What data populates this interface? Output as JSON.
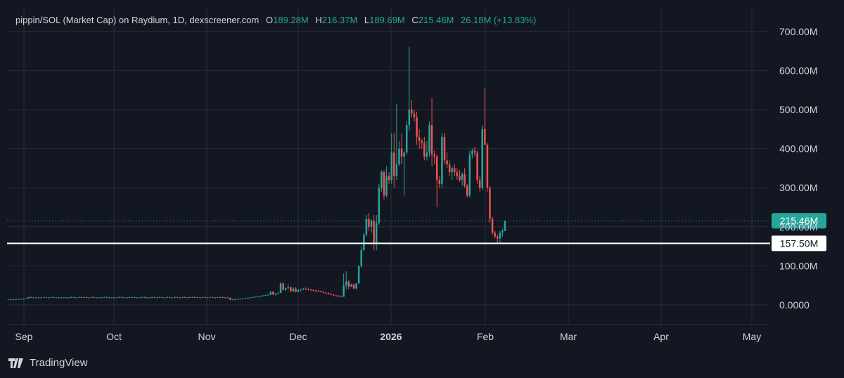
{
  "header": {
    "title": "pippin/SOL (Market Cap) on Raydium, 1D, dexscreener.com",
    "o_label": "O",
    "o_value": "189.28M",
    "h_label": "H",
    "h_value": "216.37M",
    "l_label": "L",
    "l_value": "189.69M",
    "c_label": "C",
    "c_value": "215.46M",
    "change": "26.18M (+13.83%)"
  },
  "brand": "TradingView",
  "colors": {
    "background": "#131722",
    "up": "#26a69a",
    "down": "#ef5350",
    "grid": "#2a2e39",
    "text": "#d1d4dc",
    "price_line": "#ffffff"
  },
  "chart_data": {
    "type": "candlestick",
    "y_axis": {
      "min": 0,
      "max": 700,
      "unit": "M",
      "ticks": [
        0,
        100,
        200,
        300,
        400,
        500,
        600,
        700
      ],
      "tick_labels": [
        "0.0000",
        "100.00M",
        "200.00M",
        "300.00M",
        "400.00M",
        "500.00M",
        "600.00M",
        "700.00M"
      ]
    },
    "x_axis": {
      "labels": [
        "Sep",
        "Oct",
        "Nov",
        "Dec",
        "2026",
        "Feb",
        "Mar",
        "Apr",
        "May"
      ]
    },
    "grid": true,
    "last_price": 215.46,
    "last_price_label": "215.46M",
    "horizontal_line": 157.5,
    "horizontal_line_label": "157.50M",
    "candles": [
      [
        14,
        15,
        13,
        14
      ],
      [
        14,
        15,
        13,
        14
      ],
      [
        14,
        15,
        13,
        14
      ],
      [
        14,
        16,
        13,
        15
      ],
      [
        15,
        16,
        14,
        15
      ],
      [
        15,
        16,
        14,
        15
      ],
      [
        15,
        17,
        14,
        16
      ],
      [
        16,
        18,
        15,
        17
      ],
      [
        17,
        21,
        16,
        20
      ],
      [
        20,
        21,
        18,
        19
      ],
      [
        19,
        20,
        18,
        19
      ],
      [
        19,
        20,
        18,
        19
      ],
      [
        19,
        20,
        18,
        19
      ],
      [
        19,
        20,
        18,
        19
      ],
      [
        19,
        20,
        18,
        20
      ],
      [
        20,
        20,
        18,
        19
      ],
      [
        19,
        20,
        18,
        19
      ],
      [
        19,
        21,
        18,
        20
      ],
      [
        20,
        21,
        18,
        19
      ],
      [
        19,
        20,
        18,
        19
      ],
      [
        19,
        20,
        18,
        19
      ],
      [
        19,
        20,
        18,
        19
      ],
      [
        19,
        20,
        18,
        19
      ],
      [
        19,
        20,
        18,
        19
      ],
      [
        19,
        20,
        18,
        19
      ],
      [
        19,
        21,
        18,
        20
      ],
      [
        20,
        21,
        18,
        19
      ],
      [
        19,
        20,
        18,
        19
      ],
      [
        19,
        21,
        18,
        20
      ],
      [
        20,
        21,
        18,
        19
      ],
      [
        19,
        21,
        18,
        20
      ],
      [
        20,
        21,
        18,
        19
      ],
      [
        19,
        20,
        18,
        19
      ],
      [
        19,
        21,
        18,
        20
      ],
      [
        20,
        21,
        18,
        19
      ],
      [
        19,
        20,
        18,
        19
      ],
      [
        19,
        20,
        18,
        19
      ],
      [
        19,
        20,
        18,
        19
      ],
      [
        19,
        21,
        18,
        20
      ],
      [
        20,
        21,
        18,
        19
      ],
      [
        19,
        20,
        18,
        19
      ],
      [
        19,
        20,
        18,
        19
      ],
      [
        19,
        20,
        18,
        19
      ],
      [
        19,
        20,
        18,
        19
      ],
      [
        19,
        21,
        18,
        20
      ],
      [
        20,
        21,
        18,
        19
      ],
      [
        19,
        20,
        18,
        19
      ],
      [
        19,
        20,
        18,
        19
      ],
      [
        19,
        21,
        18,
        20
      ],
      [
        20,
        21,
        18,
        20
      ],
      [
        20,
        21,
        18,
        19
      ],
      [
        19,
        20,
        18,
        19
      ],
      [
        19,
        20,
        18,
        19
      ],
      [
        19,
        21,
        18,
        20
      ],
      [
        20,
        21,
        18,
        19
      ],
      [
        19,
        20,
        18,
        19
      ],
      [
        19,
        20,
        18,
        19
      ],
      [
        19,
        21,
        18,
        20
      ],
      [
        20,
        21,
        18,
        19
      ],
      [
        19,
        20,
        18,
        19
      ],
      [
        19,
        21,
        18,
        20
      ],
      [
        20,
        21,
        18,
        19
      ],
      [
        19,
        20,
        18,
        19
      ],
      [
        19,
        21,
        18,
        20
      ],
      [
        20,
        21,
        18,
        19
      ],
      [
        19,
        20,
        18,
        19
      ],
      [
        19,
        21,
        18,
        20
      ],
      [
        20,
        21,
        18,
        19
      ],
      [
        19,
        20,
        18,
        19
      ],
      [
        19,
        21,
        18,
        20
      ],
      [
        20,
        21,
        18,
        19
      ],
      [
        19,
        20,
        18,
        19
      ],
      [
        19,
        21,
        18,
        20
      ],
      [
        20,
        21,
        18,
        19
      ],
      [
        19,
        21,
        18,
        20
      ],
      [
        20,
        21,
        18,
        19
      ],
      [
        19,
        20,
        18,
        19
      ],
      [
        19,
        21,
        18,
        20
      ],
      [
        20,
        21,
        18,
        19
      ],
      [
        19,
        20,
        18,
        19
      ],
      [
        19,
        21,
        18,
        20
      ],
      [
        20,
        21,
        18,
        19
      ],
      [
        19,
        20,
        18,
        19
      ],
      [
        19,
        21,
        18,
        20
      ],
      [
        20,
        21,
        18,
        20
      ],
      [
        20,
        21,
        18,
        19
      ],
      [
        19,
        20,
        18,
        19
      ],
      [
        19,
        20,
        18,
        18
      ],
      [
        18,
        19,
        12,
        13
      ],
      [
        13,
        15,
        12,
        14
      ],
      [
        14,
        16,
        12,
        15
      ],
      [
        15,
        16,
        13,
        15
      ],
      [
        15,
        17,
        14,
        16
      ],
      [
        16,
        17,
        15,
        16
      ],
      [
        16,
        18,
        15,
        17
      ],
      [
        17,
        19,
        16,
        18
      ],
      [
        18,
        20,
        17,
        19
      ],
      [
        19,
        21,
        18,
        20
      ],
      [
        20,
        22,
        19,
        21
      ],
      [
        21,
        23,
        20,
        22
      ],
      [
        22,
        24,
        21,
        23
      ],
      [
        23,
        25,
        22,
        24
      ],
      [
        24,
        26,
        23,
        25
      ],
      [
        25,
        27,
        24,
        26
      ],
      [
        26,
        35,
        25,
        33
      ],
      [
        33,
        36,
        25,
        27
      ],
      [
        27,
        30,
        24,
        29
      ],
      [
        29,
        33,
        27,
        31
      ],
      [
        31,
        58,
        30,
        55
      ],
      [
        55,
        57,
        37,
        39
      ],
      [
        39,
        45,
        36,
        43
      ],
      [
        43,
        52,
        40,
        45
      ],
      [
        45,
        47,
        33,
        35
      ],
      [
        35,
        45,
        33,
        42
      ],
      [
        42,
        45,
        32,
        34
      ],
      [
        34,
        40,
        32,
        38
      ],
      [
        38,
        41,
        34,
        40
      ],
      [
        40,
        44,
        38,
        42
      ],
      [
        42,
        45,
        38,
        40
      ],
      [
        40,
        42,
        37,
        39
      ],
      [
        39,
        41,
        36,
        38
      ],
      [
        38,
        40,
        35,
        37
      ],
      [
        37,
        39,
        34,
        36
      ],
      [
        36,
        38,
        33,
        35
      ],
      [
        35,
        37,
        32,
        33
      ],
      [
        33,
        35,
        30,
        31
      ],
      [
        31,
        33,
        28,
        30
      ],
      [
        30,
        32,
        27,
        28
      ],
      [
        28,
        30,
        25,
        26
      ],
      [
        26,
        28,
        23,
        24
      ],
      [
        24,
        26,
        22,
        23
      ],
      [
        23,
        25,
        21,
        22
      ],
      [
        22,
        24,
        20,
        21
      ],
      [
        21,
        80,
        21,
        50
      ],
      [
        50,
        86,
        40,
        60
      ],
      [
        60,
        65,
        40,
        47
      ],
      [
        47,
        55,
        46,
        52
      ],
      [
        52,
        55,
        40,
        42
      ],
      [
        42,
        56,
        40,
        55
      ],
      [
        55,
        100,
        55,
        100
      ],
      [
        100,
        150,
        95,
        140
      ],
      [
        140,
        185,
        138,
        180
      ],
      [
        180,
        230,
        175,
        220
      ],
      [
        220,
        235,
        190,
        200
      ],
      [
        200,
        220,
        185,
        215
      ],
      [
        215,
        230,
        140,
        160
      ],
      [
        160,
        230,
        140,
        210
      ],
      [
        210,
        310,
        205,
        300
      ],
      [
        300,
        345,
        290,
        340
      ],
      [
        340,
        345,
        270,
        280
      ],
      [
        280,
        355,
        275,
        330
      ],
      [
        330,
        340,
        310,
        320
      ],
      [
        320,
        440,
        310,
        390
      ],
      [
        390,
        440,
        300,
        330
      ],
      [
        330,
        515,
        320,
        360
      ],
      [
        360,
        420,
        355,
        400
      ],
      [
        400,
        440,
        360,
        380
      ],
      [
        380,
        395,
        280,
        390
      ],
      [
        390,
        470,
        385,
        460
      ],
      [
        460,
        660,
        445,
        500
      ],
      [
        500,
        525,
        480,
        490
      ],
      [
        490,
        500,
        470,
        480
      ],
      [
        480,
        495,
        410,
        430
      ],
      [
        430,
        450,
        400,
        420
      ],
      [
        420,
        425,
        400,
        415
      ],
      [
        415,
        430,
        370,
        380
      ],
      [
        380,
        420,
        370,
        390
      ],
      [
        390,
        470,
        380,
        460
      ],
      [
        460,
        530,
        355,
        385
      ],
      [
        385,
        395,
        360,
        380
      ],
      [
        380,
        385,
        250,
        320
      ],
      [
        320,
        330,
        300,
        310
      ],
      [
        310,
        440,
        300,
        430
      ],
      [
        430,
        440,
        360,
        370
      ],
      [
        370,
        390,
        350,
        360
      ],
      [
        360,
        370,
        330,
        340
      ],
      [
        340,
        355,
        320,
        350
      ],
      [
        350,
        360,
        330,
        340
      ],
      [
        340,
        350,
        320,
        330
      ],
      [
        330,
        345,
        315,
        320
      ],
      [
        320,
        340,
        305,
        335
      ],
      [
        335,
        350,
        300,
        305
      ],
      [
        305,
        310,
        275,
        280
      ],
      [
        280,
        395,
        275,
        385
      ],
      [
        385,
        400,
        375,
        395
      ],
      [
        395,
        405,
        380,
        390
      ],
      [
        390,
        395,
        310,
        320
      ],
      [
        320,
        330,
        290,
        300
      ],
      [
        300,
        460,
        295,
        450
      ],
      [
        450,
        555,
        420,
        410
      ],
      [
        410,
        415,
        290,
        300
      ],
      [
        300,
        305,
        210,
        220
      ],
      [
        220,
        225,
        180,
        185
      ],
      [
        185,
        190,
        170,
        175
      ],
      [
        175,
        180,
        160,
        170
      ],
      [
        170,
        190,
        160,
        185
      ],
      [
        185,
        195,
        175,
        190
      ],
      [
        189,
        216,
        190,
        215
      ]
    ]
  }
}
